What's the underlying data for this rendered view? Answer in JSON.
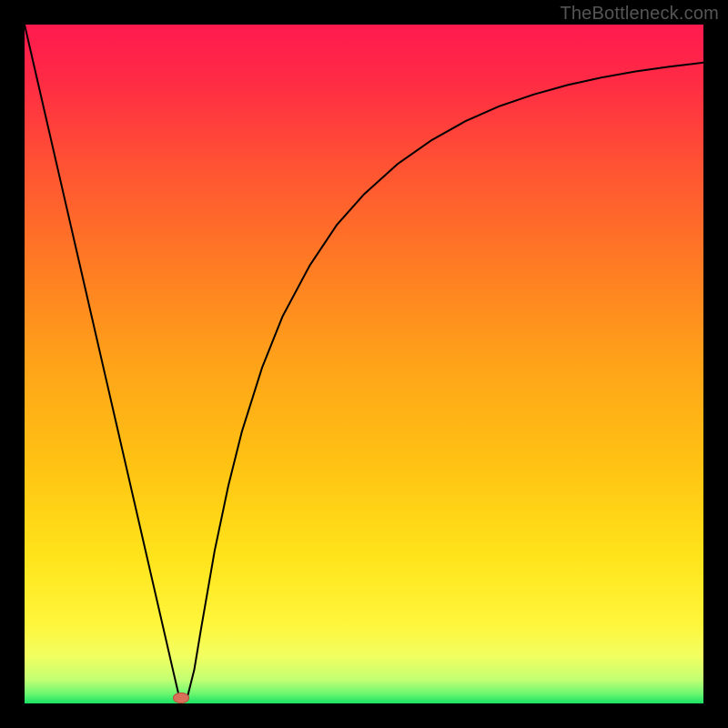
{
  "watermark": "TheBottleneck.com",
  "colors": {
    "frame": "#000000",
    "curve": "#000000",
    "marker_fill": "#d9705a",
    "marker_stroke": "#b85040",
    "gradient_stops": [
      {
        "offset": 0.0,
        "color": "#ff1a4f"
      },
      {
        "offset": 0.08,
        "color": "#ff2a45"
      },
      {
        "offset": 0.2,
        "color": "#ff5034"
      },
      {
        "offset": 0.35,
        "color": "#ff7a24"
      },
      {
        "offset": 0.5,
        "color": "#ffa319"
      },
      {
        "offset": 0.65,
        "color": "#ffc313"
      },
      {
        "offset": 0.78,
        "color": "#ffe31a"
      },
      {
        "offset": 0.88,
        "color": "#fff53a"
      },
      {
        "offset": 0.93,
        "color": "#f2ff60"
      },
      {
        "offset": 0.965,
        "color": "#c3ff74"
      },
      {
        "offset": 0.985,
        "color": "#70f870"
      },
      {
        "offset": 1.0,
        "color": "#18e264"
      }
    ]
  },
  "chart_data": {
    "type": "line",
    "title": "",
    "xlabel": "",
    "ylabel": "",
    "xlim": [
      0,
      100
    ],
    "ylim": [
      0,
      100
    ],
    "grid": false,
    "legend": false,
    "series": [
      {
        "name": "bottleneck-curve",
        "x": [
          0,
          2,
          4,
          6,
          8,
          10,
          12,
          14,
          16,
          18,
          20,
          22,
          23,
          24,
          25,
          26,
          28,
          30,
          32,
          35,
          38,
          42,
          46,
          50,
          55,
          60,
          65,
          70,
          75,
          80,
          85,
          90,
          95,
          100
        ],
        "y": [
          100,
          91.3,
          82.6,
          73.9,
          65.2,
          56.5,
          47.8,
          39.1,
          30.4,
          21.7,
          13.0,
          4.3,
          0.0,
          1.0,
          5.0,
          11.0,
          22.5,
          32.0,
          40.0,
          49.5,
          57.0,
          64.5,
          70.5,
          75.0,
          79.5,
          83.0,
          85.8,
          88.0,
          89.7,
          91.1,
          92.2,
          93.1,
          93.8,
          94.4
        ]
      }
    ],
    "marker": {
      "name": "min-point",
      "x": 23,
      "y": 0,
      "width_units": 2.4,
      "height_units": 1.6
    }
  }
}
